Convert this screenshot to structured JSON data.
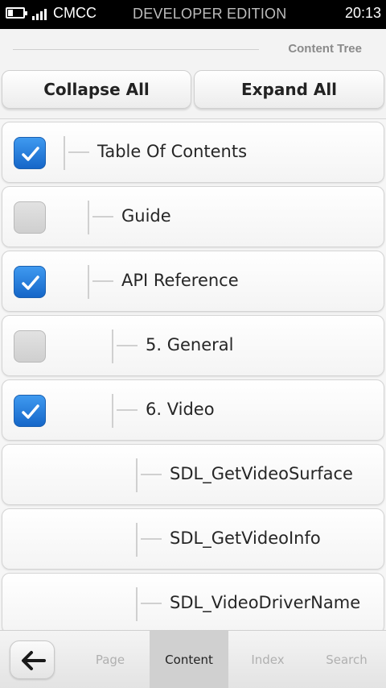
{
  "status_bar": {
    "carrier": "CMCC",
    "edition": "DEVELOPER EDITION",
    "time": "20:13"
  },
  "header": {
    "title": "Content Tree"
  },
  "actions": {
    "collapse_label": "Collapse All",
    "expand_label": "Expand All"
  },
  "tree": {
    "items": [
      {
        "label": "Table Of Contents",
        "depth": 0,
        "checkbox": "checked"
      },
      {
        "label": "Guide",
        "depth": 1,
        "checkbox": "unchecked"
      },
      {
        "label": "API Reference",
        "depth": 1,
        "checkbox": "checked"
      },
      {
        "label": "5. General",
        "depth": 2,
        "checkbox": "unchecked"
      },
      {
        "label": "6. Video",
        "depth": 2,
        "checkbox": "checked"
      },
      {
        "label": "SDL_GetVideoSurface",
        "depth": 3,
        "checkbox": "none"
      },
      {
        "label": "SDL_GetVideoInfo",
        "depth": 3,
        "checkbox": "none"
      },
      {
        "label": "SDL_VideoDriverName",
        "depth": 3,
        "checkbox": "none"
      }
    ]
  },
  "toolbar": {
    "back_icon": "back-arrow-icon",
    "tabs": [
      {
        "label": "Page",
        "active": false
      },
      {
        "label": "Content",
        "active": true
      },
      {
        "label": "Index",
        "active": false
      },
      {
        "label": "Search",
        "active": false
      }
    ]
  },
  "colors": {
    "checkbox_checked": "#1f78dc",
    "checkbox_unchecked": "#d6d6d6",
    "active_tab": "#d0d0d0"
  }
}
